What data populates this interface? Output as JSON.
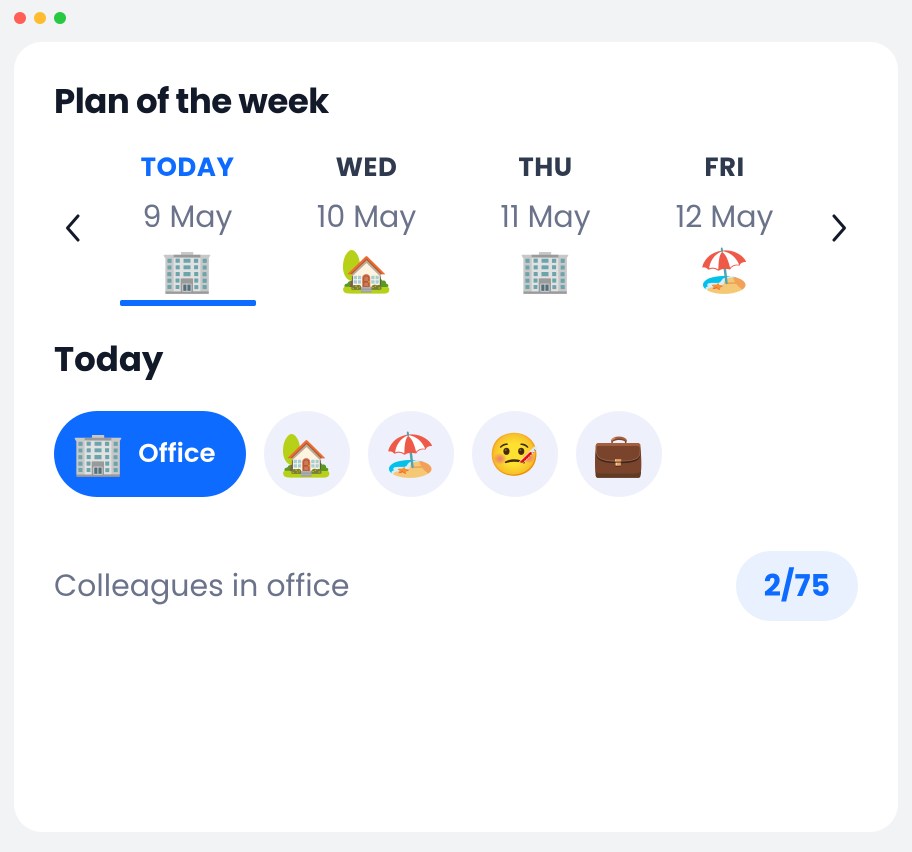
{
  "header": {
    "title": "Plan of the week"
  },
  "week": {
    "days": [
      {
        "label": "TODAY",
        "date": "9 May",
        "icon": "🏢",
        "active": true
      },
      {
        "label": "WED",
        "date": "10 May",
        "icon": "🏡",
        "active": false
      },
      {
        "label": "THU",
        "date": "11 May",
        "icon": "🏢",
        "active": false
      },
      {
        "label": "FRI",
        "date": "12 May",
        "icon": "🏖️",
        "active": false
      }
    ]
  },
  "today": {
    "title": "Today",
    "statuses": [
      {
        "icon": "🏢",
        "label": "Office",
        "active": true,
        "name": "office"
      },
      {
        "icon": "🏡",
        "label": "",
        "active": false,
        "name": "home"
      },
      {
        "icon": "🏖️",
        "label": "",
        "active": false,
        "name": "vacation"
      },
      {
        "icon": "🤒",
        "label": "",
        "active": false,
        "name": "sick"
      },
      {
        "icon": "💼",
        "label": "",
        "active": false,
        "name": "business"
      }
    ]
  },
  "colleagues": {
    "label": "Colleagues in office",
    "count": "2/75"
  }
}
